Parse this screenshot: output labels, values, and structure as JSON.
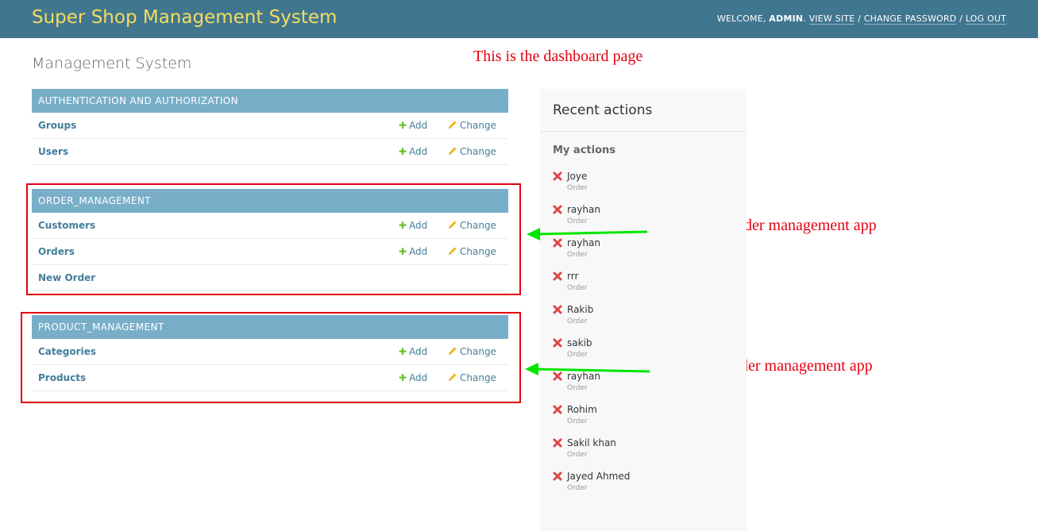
{
  "header": {
    "branding": "Super Shop Management System",
    "welcome": "WELCOME, ",
    "user": "ADMIN",
    "view_site": "VIEW SITE",
    "change_password": "CHANGE PASSWORD",
    "log_out": "LOG OUT",
    "separator": " / "
  },
  "page_title": "Management System",
  "annotations": {
    "dashboard": "This is the dashboard page",
    "order_app_1": "This is the order management app",
    "order_app_2": "This is the order management app"
  },
  "modules": [
    {
      "caption": "AUTHENTICATION AND AUTHORIZATION",
      "rows": [
        {
          "name": "Groups",
          "add": "Add",
          "change": "Change"
        },
        {
          "name": "Users",
          "add": "Add",
          "change": "Change"
        }
      ]
    },
    {
      "caption": "ORDER_MANAGEMENT",
      "rows": [
        {
          "name": "Customers",
          "add": "Add",
          "change": "Change"
        },
        {
          "name": "Orders",
          "add": "Add",
          "change": "Change"
        },
        {
          "name": "New Order"
        }
      ]
    },
    {
      "caption": "PRODUCT_MANAGEMENT",
      "rows": [
        {
          "name": "Categories",
          "add": "Add",
          "change": "Change"
        },
        {
          "name": "Products",
          "add": "Add",
          "change": "Change"
        }
      ]
    }
  ],
  "recent_actions": {
    "title": "Recent actions",
    "subtitle": "My actions",
    "items": [
      {
        "name": "Joye",
        "type": "Order"
      },
      {
        "name": "rayhan",
        "type": "Order"
      },
      {
        "name": "rayhan",
        "type": "Order"
      },
      {
        "name": "rrr",
        "type": "Order"
      },
      {
        "name": "Rakib",
        "type": "Order"
      },
      {
        "name": "sakib",
        "type": "Order"
      },
      {
        "name": "rayhan",
        "type": "Order"
      },
      {
        "name": "Rohim",
        "type": "Order"
      },
      {
        "name": "Sakil khan",
        "type": "Order"
      },
      {
        "name": "Jayed Ahmed",
        "type": "Order"
      }
    ]
  },
  "colors": {
    "header_bg": "#417690",
    "branding": "#f5dd5d",
    "caption_bg": "#79aec8",
    "link": "#447e9b",
    "add_icon": "#70bf2b",
    "change_icon": "#efb80b",
    "delete_icon": "#dd4646",
    "annotation": "#e3000f",
    "arrow": "#00e600"
  }
}
